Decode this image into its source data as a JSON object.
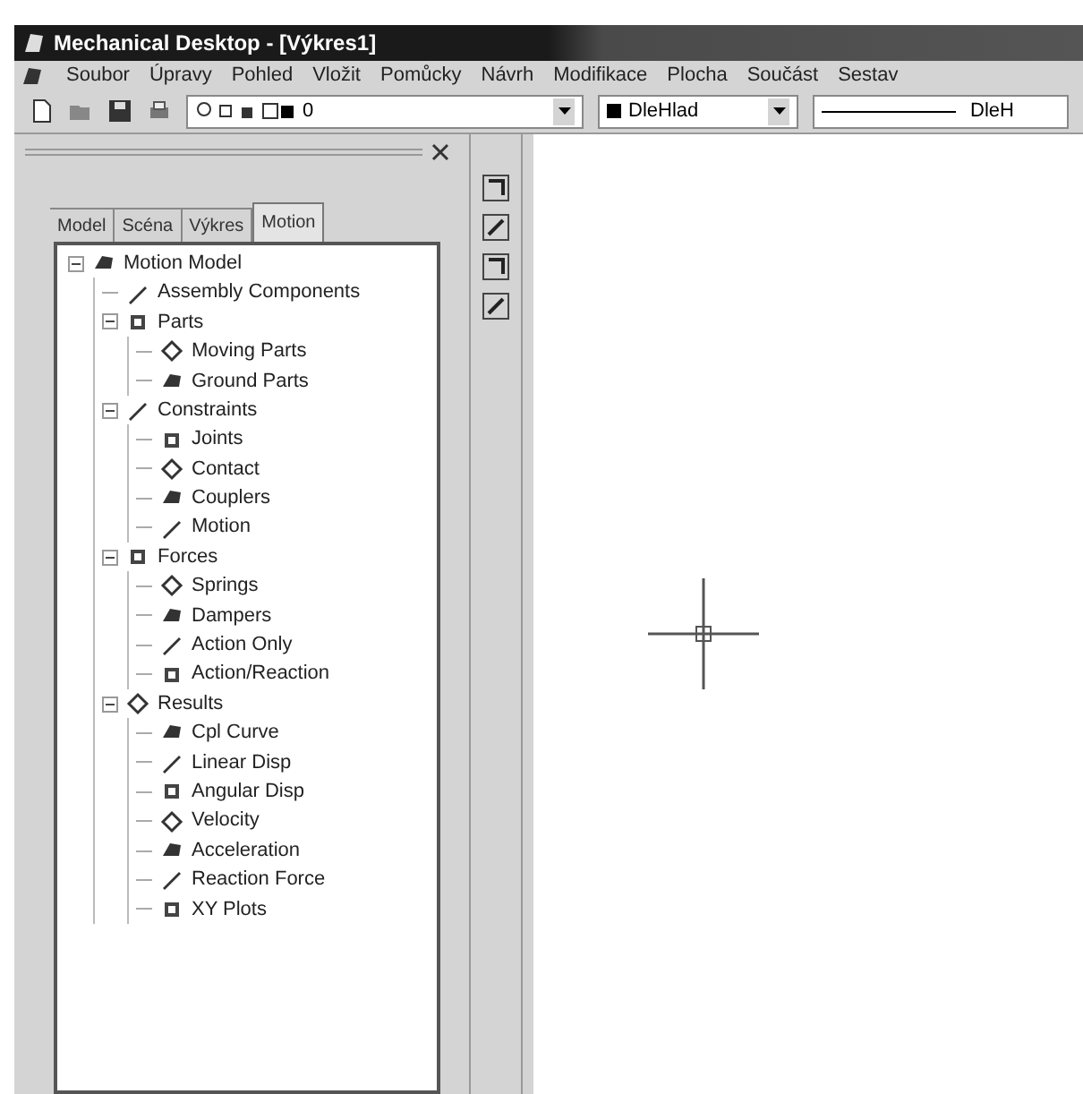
{
  "window": {
    "title": "Mechanical Desktop - [Výkres1]"
  },
  "menu": [
    "Soubor",
    "Úpravy",
    "Pohled",
    "Vložit",
    "Pomůcky",
    "Návrh",
    "Modifikace",
    "Plocha",
    "Součást",
    "Sestav"
  ],
  "toolbar": {
    "layer": "0",
    "color_setting": "DleHlad",
    "linetype": "DleH"
  },
  "tabs": [
    {
      "label": "Model",
      "selected": false
    },
    {
      "label": "Scéna",
      "selected": false
    },
    {
      "label": "Výkres",
      "selected": false
    },
    {
      "label": "Motion",
      "selected": true
    }
  ],
  "tree": [
    {
      "label": "Motion Model",
      "expanded": true,
      "children": [
        {
          "label": "Assembly Components"
        },
        {
          "label": "Parts",
          "expanded": true,
          "children": [
            {
              "label": "Moving Parts"
            },
            {
              "label": "Ground Parts"
            }
          ]
        },
        {
          "label": "Constraints",
          "expanded": true,
          "children": [
            {
              "label": "Joints"
            },
            {
              "label": "Contact"
            },
            {
              "label": "Couplers"
            },
            {
              "label": "Motion"
            }
          ]
        },
        {
          "label": "Forces",
          "expanded": true,
          "children": [
            {
              "label": "Springs"
            },
            {
              "label": "Dampers"
            },
            {
              "label": "Action Only"
            },
            {
              "label": "Action/Reaction"
            }
          ]
        },
        {
          "label": "Results",
          "expanded": true,
          "children": [
            {
              "label": "Cpl Curve"
            },
            {
              "label": "Linear Disp"
            },
            {
              "label": "Angular Disp"
            },
            {
              "label": "Velocity"
            },
            {
              "label": "Acceleration"
            },
            {
              "label": "Reaction Force"
            },
            {
              "label": "XY Plots"
            }
          ]
        }
      ]
    }
  ]
}
